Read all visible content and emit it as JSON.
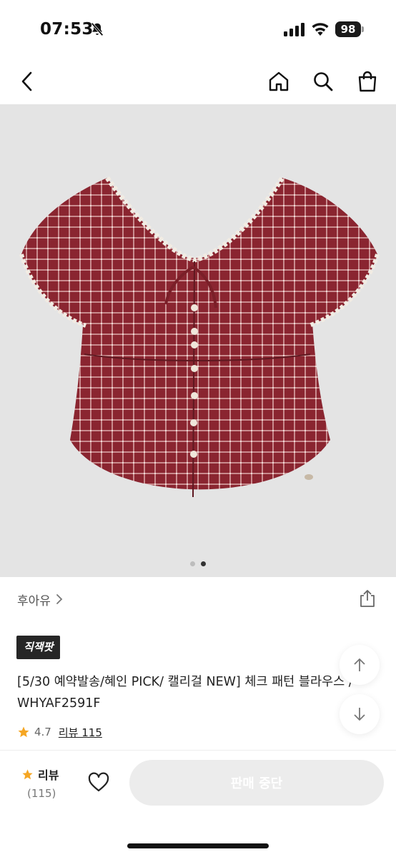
{
  "status_bar": {
    "time": "07:53",
    "battery": "98"
  },
  "nav": {
    "icons": [
      "back-icon",
      "home-icon",
      "search-icon",
      "shopping-bag-icon"
    ]
  },
  "gallery": {
    "image": "red gingham short-sleeve blouse",
    "page_count": 2,
    "current_page": 2
  },
  "product": {
    "brand": "후아유",
    "badge": "직잭팟",
    "title": "[5/30 예약발송/혜인 PICK/ 캘리걸 NEW] 체크 패턴 블라우스 / WHYAF2591F",
    "rating": "4.7",
    "review_link": "리뷰 115"
  },
  "bottom_bar": {
    "review_label": "리뷰",
    "review_count": "(115)",
    "cta_label": "판매 중단"
  },
  "colors": {
    "star": "#f5a623",
    "cta_bg": "#ececec",
    "badge_bg": "#262626",
    "blouse": "#8a2530"
  }
}
